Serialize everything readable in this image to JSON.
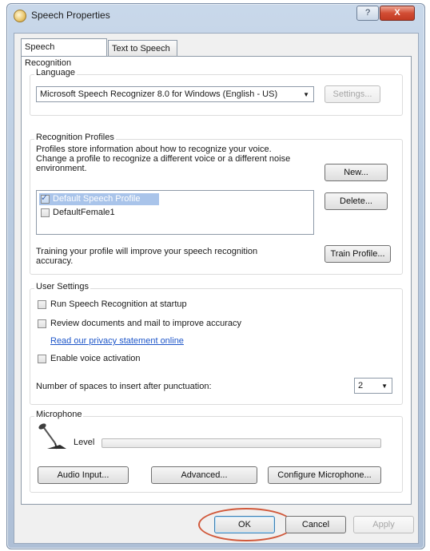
{
  "window": {
    "title": "Speech Properties",
    "help_label": "?",
    "close_label": "X"
  },
  "tabs": [
    {
      "label": "Speech Recognition",
      "active": true
    },
    {
      "label": "Text to Speech",
      "active": false
    }
  ],
  "language": {
    "group_label": "Language",
    "recognizer": "Microsoft Speech Recognizer 8.0 for Windows (English - US)",
    "settings_label": "Settings..."
  },
  "profiles": {
    "group_label": "Recognition Profiles",
    "description_line1": "Profiles store information about how to recognize your voice.",
    "description_line2": "Change a profile to recognize a different voice or a different noise",
    "description_line3": "environment.",
    "new_label": "New...",
    "delete_label": "Delete...",
    "items": [
      {
        "label": "Default Speech Profile",
        "checked": true,
        "selected": true
      },
      {
        "label": "DefaultFemale1",
        "checked": false,
        "selected": false
      }
    ],
    "training_line1": "Training your profile will improve your speech recognition",
    "training_line2": "accuracy.",
    "train_label": "Train Profile..."
  },
  "user_settings": {
    "group_label": "User Settings",
    "run_at_startup": "Run Speech Recognition at startup",
    "review_documents": "Review documents and mail to improve accuracy",
    "privacy_link": "Read our privacy statement online",
    "voice_activation": "Enable voice activation",
    "spaces_label": "Number of spaces to insert after punctuation:",
    "spaces_value": "2"
  },
  "microphone": {
    "group_label": "Microphone",
    "level_label": "Level",
    "level_fraction": 0,
    "audio_input_label": "Audio Input...",
    "advanced_label": "Advanced...",
    "configure_label": "Configure Microphone..."
  },
  "footer": {
    "ok_label": "OK",
    "cancel_label": "Cancel",
    "apply_label": "Apply"
  },
  "colors": {
    "selection": "#a9c4ea",
    "link": "#1e56c9",
    "highlight_circle": "#d1593b"
  }
}
